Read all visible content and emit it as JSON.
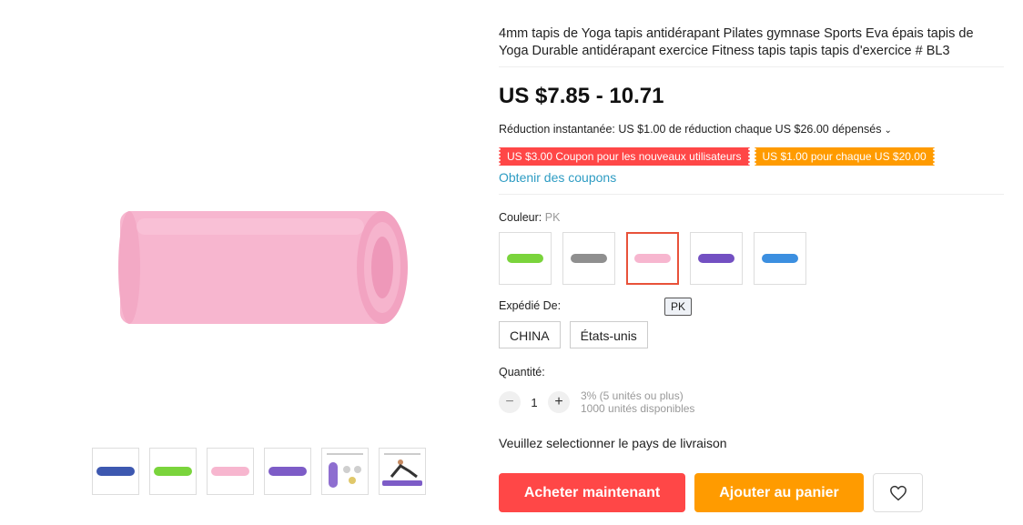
{
  "product": {
    "title": "4mm tapis de Yoga tapis antidérapant Pilates gymnase Sports Eva épais tapis de Yoga Durable antidérapant exercice Fitness tapis tapis tapis d'exercice # BL3",
    "price": "US $7.85 - 10.71",
    "discount_text": "Réduction instantanée: US $1.00 de réduction chaque US $26.00 dépensés",
    "coupons": [
      "US $3.00 Coupon pour les nouveaux utilisateurs",
      "US $1.00 pour chaque US $20.00"
    ],
    "get_coupons": "Obtenir des coupons"
  },
  "gallery": {
    "main_color": "#f7b6cf",
    "thumbnails": [
      {
        "color": "#3d58b0"
      },
      {
        "color": "#7ad43c"
      },
      {
        "color": "#f7b6cf"
      },
      {
        "color": "#7d5cc7"
      },
      {
        "color": "#8e6ed0"
      },
      {
        "color": "#7d5cc7"
      }
    ]
  },
  "color": {
    "label": "Couleur:",
    "selected": "PK",
    "tooltip": "PK",
    "options": [
      {
        "color": "#7ad43c"
      },
      {
        "color": "#8f8f8f"
      },
      {
        "color": "#f7b6cf"
      },
      {
        "color": "#7350c2"
      },
      {
        "color": "#3c8fe0"
      }
    ]
  },
  "shipping": {
    "label": "Expédié De:",
    "options": [
      "CHINA",
      "États-unis"
    ]
  },
  "quantity": {
    "label": "Quantité:",
    "value": "1",
    "minus": "−",
    "plus": "+",
    "discount": "3% (5 unités ou plus)",
    "available": "1000 unités disponibles"
  },
  "shipping_message": "Veuillez selectionner le pays de livraison",
  "actions": {
    "buy_now": "Acheter maintenant",
    "add_to_cart": "Ajouter au panier"
  }
}
